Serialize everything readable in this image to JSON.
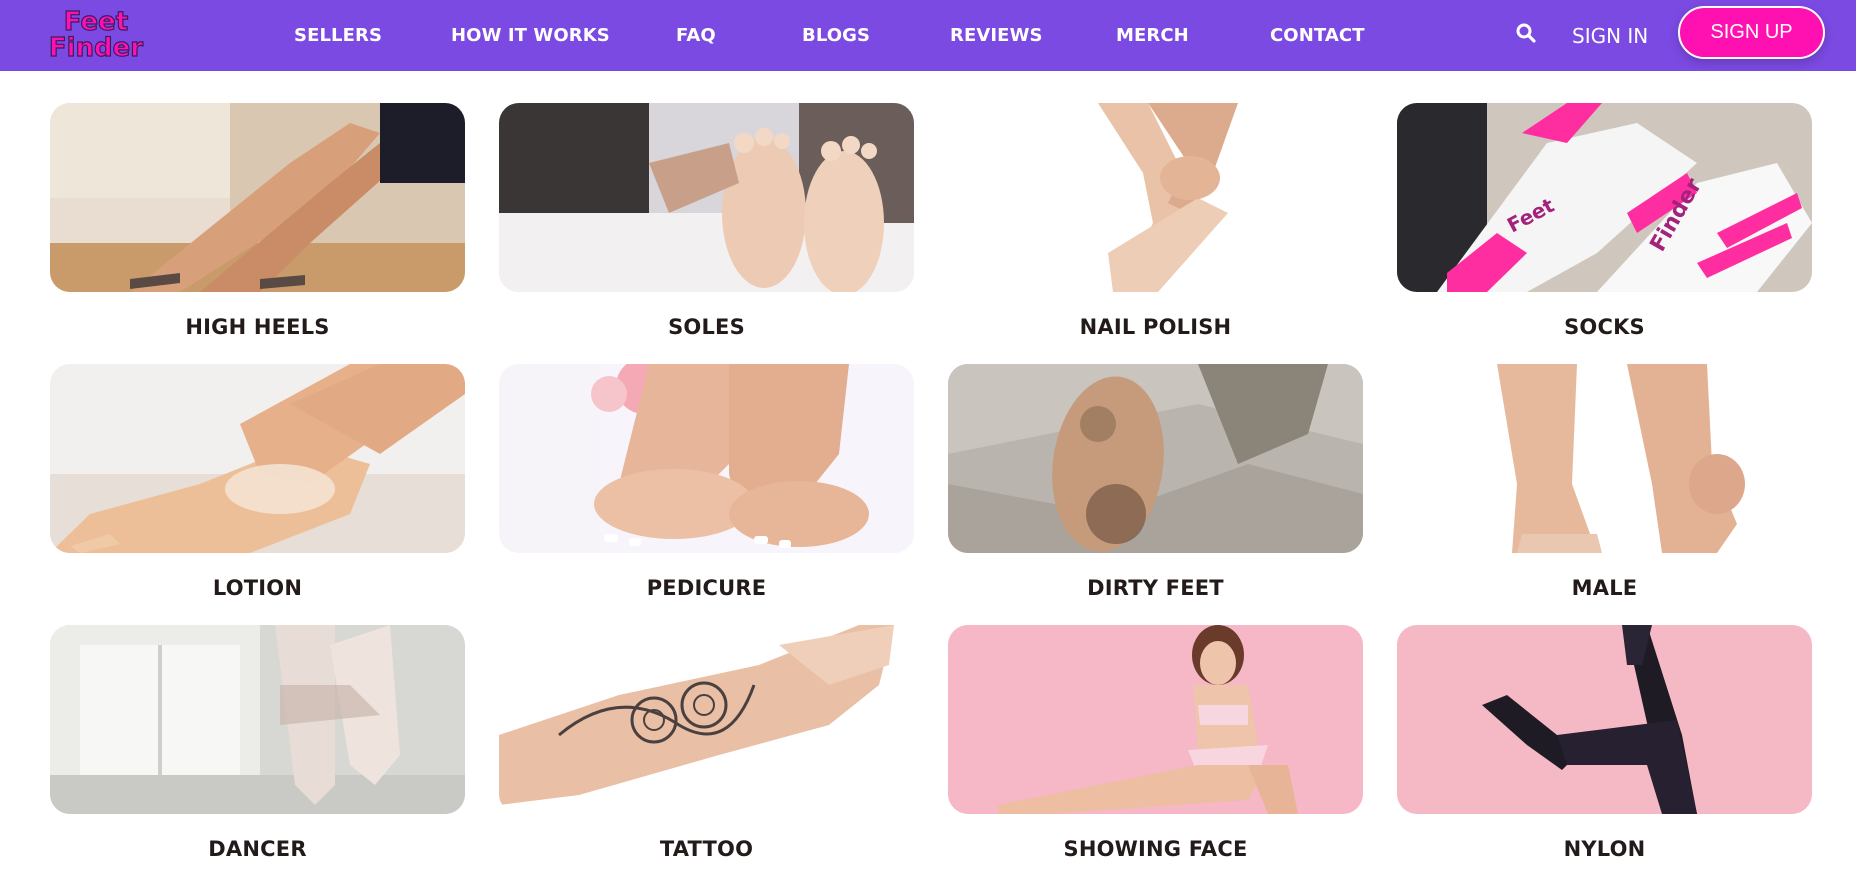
{
  "brand": {
    "logo_text_line1": "Feet",
    "logo_text_line2": "Finder",
    "nav_bg": "#7b4ae2",
    "accent_pink": "#ff10b0",
    "label_color": "#231a1a"
  },
  "nav": {
    "links": [
      {
        "label": "SELLERS"
      },
      {
        "label": "HOW IT WORKS"
      },
      {
        "label": "FAQ"
      },
      {
        "label": "BLOGS"
      },
      {
        "label": "REVIEWS"
      },
      {
        "label": "MERCH"
      },
      {
        "label": "CONTACT"
      }
    ],
    "search_icon": "search-icon",
    "signin_label": "SIGN IN",
    "signup_label": "SIGN UP"
  },
  "categories": [
    {
      "label": "HIGH HEELS"
    },
    {
      "label": "SOLES"
    },
    {
      "label": "NAIL POLISH"
    },
    {
      "label": "SOCKS"
    },
    {
      "label": "LOTION"
    },
    {
      "label": "PEDICURE"
    },
    {
      "label": "DIRTY FEET"
    },
    {
      "label": "MALE"
    },
    {
      "label": "DANCER"
    },
    {
      "label": "TATTOO"
    },
    {
      "label": "SHOWING FACE"
    },
    {
      "label": "NYLON"
    }
  ]
}
